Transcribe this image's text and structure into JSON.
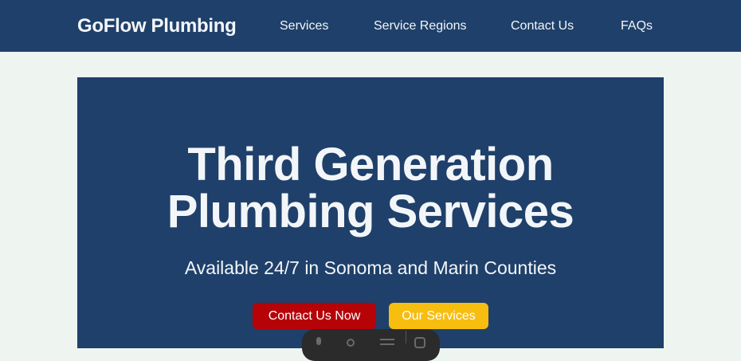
{
  "header": {
    "brand": "GoFlow Plumbing",
    "nav": [
      "Services",
      "Service Regions",
      "Contact Us",
      "FAQs"
    ]
  },
  "hero": {
    "title_line1": "Third Generation",
    "title_line2": "Plumbing Services",
    "subtitle": "Available 24/7 in Sonoma and Marin Counties",
    "primary_button": "Contact Us Now",
    "secondary_button": "Our Services"
  },
  "floating_toolbar": {
    "icons": [
      "mic-icon",
      "settings-icon",
      "menu-icon",
      "extension-icon"
    ]
  },
  "colors": {
    "navy": "#1f406a",
    "page_bg": "#eef4f0",
    "red": "#b60308",
    "yellow": "#f7bd0f",
    "text_light": "#f3f6f9"
  }
}
